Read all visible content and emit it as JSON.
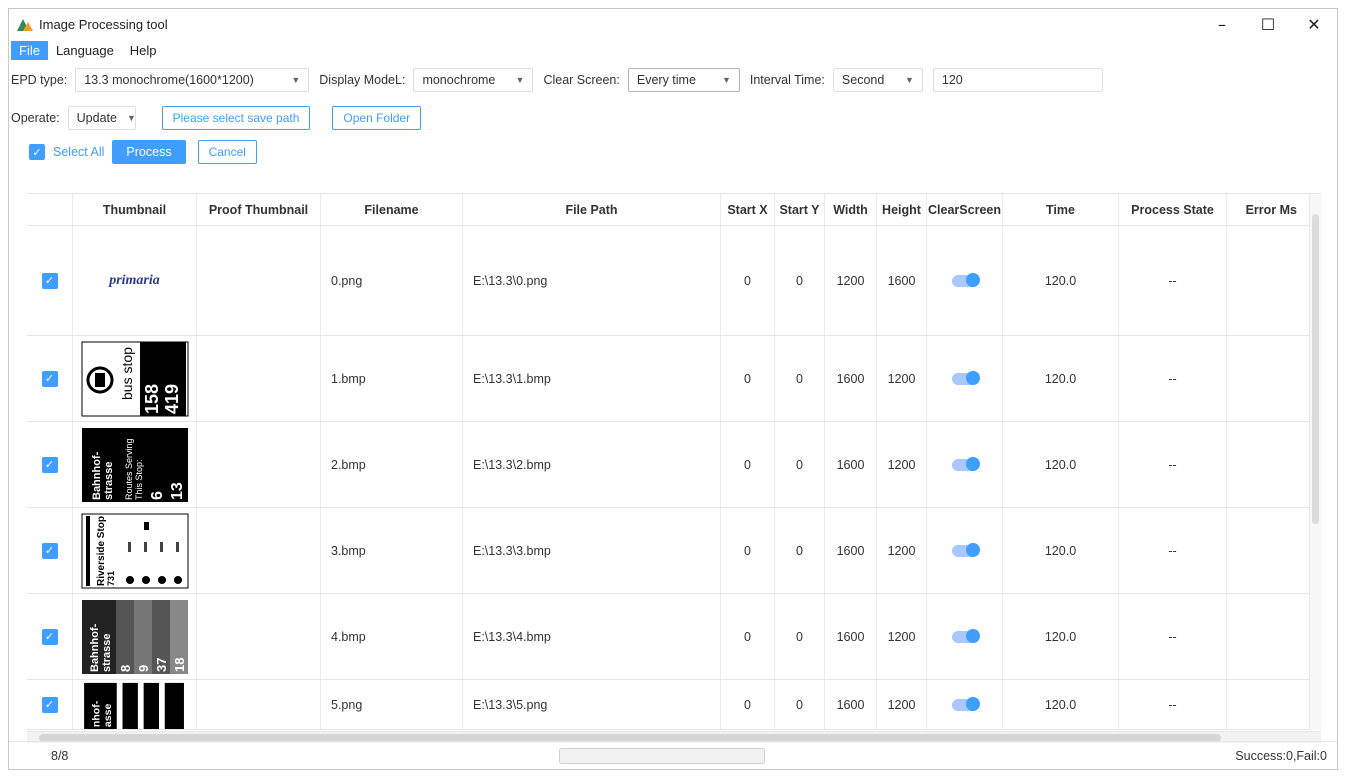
{
  "window": {
    "title": "Image Processing tool",
    "controls": {
      "minimize": "–",
      "maximize": "☐",
      "close": "✕"
    }
  },
  "menu": [
    {
      "label": "File",
      "active": true
    },
    {
      "label": "Language"
    },
    {
      "label": "Help"
    }
  ],
  "settings": {
    "epd_type_label": "EPD type:",
    "epd_type_value": "13.3 monochrome(1600*1200)",
    "display_model_label": "Display ModeL:",
    "display_model_value": "monochrome",
    "clear_screen_label": "Clear Screen:",
    "clear_screen_value": "Every time",
    "interval_time_label": "Interval Time:",
    "interval_unit_value": "Second",
    "interval_value": "120",
    "operate_label": "Operate:",
    "operate_value": "Update",
    "save_path_button": "Please select save path",
    "open_folder_button": "Open Folder"
  },
  "actions": {
    "select_all": "Select All",
    "process": "Process",
    "cancel": "Cancel"
  },
  "table": {
    "columns": [
      "Thumbnail",
      "Proof Thumbnail",
      "Filename",
      "File Path",
      "Start X",
      "Start Y",
      "Width",
      "Height",
      "ClearScreen",
      "Time",
      "Process State",
      "Error Ms"
    ],
    "rows": [
      {
        "thumb": "primaria",
        "filename": "0.png",
        "path": "E:\\13.3\\0.png",
        "x": "0",
        "y": "0",
        "w": "1200",
        "h": "1600",
        "time": "120.0",
        "state": "--"
      },
      {
        "thumb": "bus-stop",
        "filename": "1.bmp",
        "path": "E:\\13.3\\1.bmp",
        "x": "0",
        "y": "0",
        "w": "1600",
        "h": "1200",
        "time": "120.0",
        "state": "--"
      },
      {
        "thumb": "bahnhof-strasse",
        "filename": "2.bmp",
        "path": "E:\\13.3\\2.bmp",
        "x": "0",
        "y": "0",
        "w": "1600",
        "h": "1200",
        "time": "120.0",
        "state": "--"
      },
      {
        "thumb": "riverside-stop",
        "filename": "3.bmp",
        "path": "E:\\13.3\\3.bmp",
        "x": "0",
        "y": "0",
        "w": "1600",
        "h": "1200",
        "time": "120.0",
        "state": "--"
      },
      {
        "thumb": "bahnhof-strasse-grey",
        "filename": "4.bmp",
        "path": "E:\\13.3\\4.bmp",
        "x": "0",
        "y": "0",
        "w": "1600",
        "h": "1200",
        "time": "120.0",
        "state": "--"
      },
      {
        "thumb": "bahnhof-strasse-bw",
        "filename": "5.png",
        "path": "E:\\13.3\\5.png",
        "x": "0",
        "y": "0",
        "w": "1600",
        "h": "1200",
        "time": "120.0",
        "state": "--"
      }
    ],
    "thumb_texts": {
      "primaria": "primaria",
      "bus": [
        "bus stop",
        "158",
        "419"
      ],
      "bahnhof": [
        "Bahnhof-",
        "strasse",
        "Routes Serving",
        "This Stop:",
        "6",
        "13"
      ],
      "riverside": [
        "Riverside Stop",
        "731"
      ],
      "grey": [
        "Bahnhof-",
        "strasse",
        "8",
        "9",
        "37",
        "18"
      ],
      "bw": [
        "nhof-",
        "asse"
      ]
    }
  },
  "status": {
    "count": "8/8",
    "progress": 0.0,
    "result": "Success:0,Fail:0"
  },
  "colors": {
    "accent": "#409eff",
    "toggle_track": "#a8c8ff"
  }
}
